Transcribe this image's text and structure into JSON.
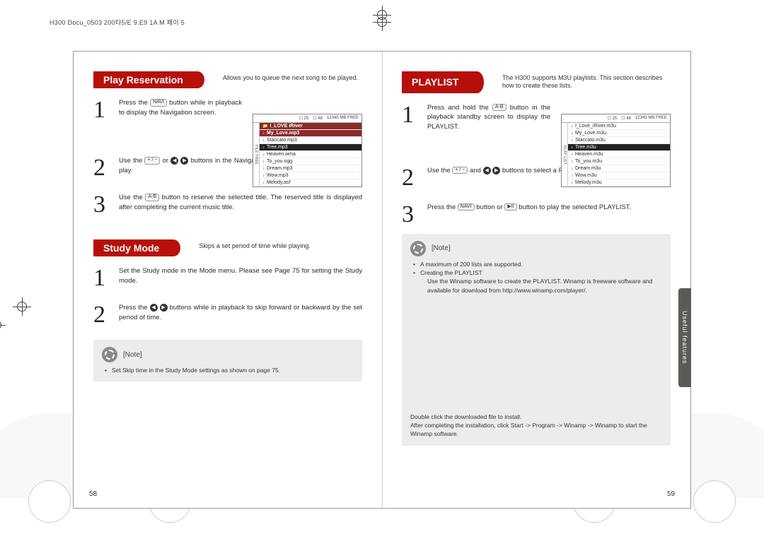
{
  "crop_mark_text": "H300 Docu_0503  200타5/E 9.E9 1A M 페이 5",
  "left_page_number": "58",
  "right_page_number": "59",
  "side_tab": "Useful features",
  "left": {
    "section1": {
      "title": "Play Reservation",
      "subtitle": "Allows you to queue the next song to be played.",
      "steps": {
        "s1": {
          "num": "1",
          "pre": "Press the ",
          "btn1": "NAVI",
          "post": " button while in playback to display the Navigation screen."
        },
        "s2": {
          "num": "2",
          "pre": "Use the ",
          "btn1": "+ / −",
          "mid1": " or ",
          "btn2": "◀",
          "mid2": " ",
          "btn3": "▶",
          "post": " buttons in the Navigation screen to select a music title to play."
        },
        "s3": {
          "num": "3",
          "pre": "Use the ",
          "btn1": "A-B",
          "post": " button to reserve the selected title. The reserved title is displayed after completing the current music title."
        }
      },
      "screen": {
        "status1": "25",
        "status2": "48",
        "status3": "12345 MB FREE",
        "tabs1": "FILE",
        "tabs2": "TREE",
        "items": [
          "I_LOVE  iRiver",
          "My_Love.mp3",
          "Staccato.mp3",
          "Tree.mp3",
          "Heaven.wma",
          "To_you.ogg",
          "Dream.mp3",
          "Wow.mp3",
          "Melody.asf"
        ]
      }
    },
    "section2": {
      "title": "Study Mode",
      "subtitle": "Skips a set period of time while playing.",
      "steps": {
        "s1": {
          "num": "1",
          "text": "Set the Study mode in the Mode menu. Please see Page 75 for setting the Study mode."
        },
        "s2": {
          "num": "2",
          "pre": "Press the ",
          "btn1": "◀",
          "mid": " ",
          "btn2": "▶",
          "post": " buttons while in playback to skip forward or backward by the set period of time."
        }
      },
      "note": {
        "label": "[Note]",
        "line1": "Set Skip time in the Study Mode settings as shown on page 75."
      }
    }
  },
  "right": {
    "section": {
      "title": "PLAYLIST",
      "subtitle": "The H300 supports M3U playlists.   This section describes how to create these lists.",
      "steps": {
        "s1": {
          "num": "1",
          "pre": "Press and hold the ",
          "btn1": "A-B",
          "post": " button in the playback standby screen to display the PLAYLIST."
        },
        "s2": {
          "num": "2",
          "pre": "Use the ",
          "btn1": "+ / −",
          "mid1": " and ",
          "btn2": "◀",
          "mid2": " ",
          "btn3": "▶",
          "post": " buttons to select a PLAYLIST in the PLAYLIST screen."
        },
        "s3": {
          "num": "3",
          "pre": "Press the ",
          "btn1": "NAVI",
          "mid": " button or ",
          "btn2": "▶II",
          "post": " button to play the selected PLAYLIST."
        }
      },
      "screen": {
        "status1": "25",
        "status2": "48",
        "status3": "12345 MB FREE",
        "tabs1": "PLAY",
        "tabs2": "LIST",
        "items": [
          "I_Love_iRiver.m3u",
          "My_Love.m3u",
          "Staccato.m3u",
          "Tree.m3u",
          "Heaven.m3u",
          "To_you.m3u",
          "Dream.m3u",
          "Wow.m3u",
          "Melody.m3u"
        ]
      },
      "note": {
        "label": "[Note]",
        "line1": "A maximum of 200 lists are supported.",
        "line2": "Creating the PLAYLIST",
        "line3": "Use the Winamp software to create the PLAYLIST. Winamp is freeware software and available for download from http://www.winamp.com/player/.",
        "foot1": "Double click the downloaded file to install.",
        "foot2": "After completing the installation, click Start -> Program -> Winamp -> Winamp to start the Winamp software."
      }
    }
  }
}
